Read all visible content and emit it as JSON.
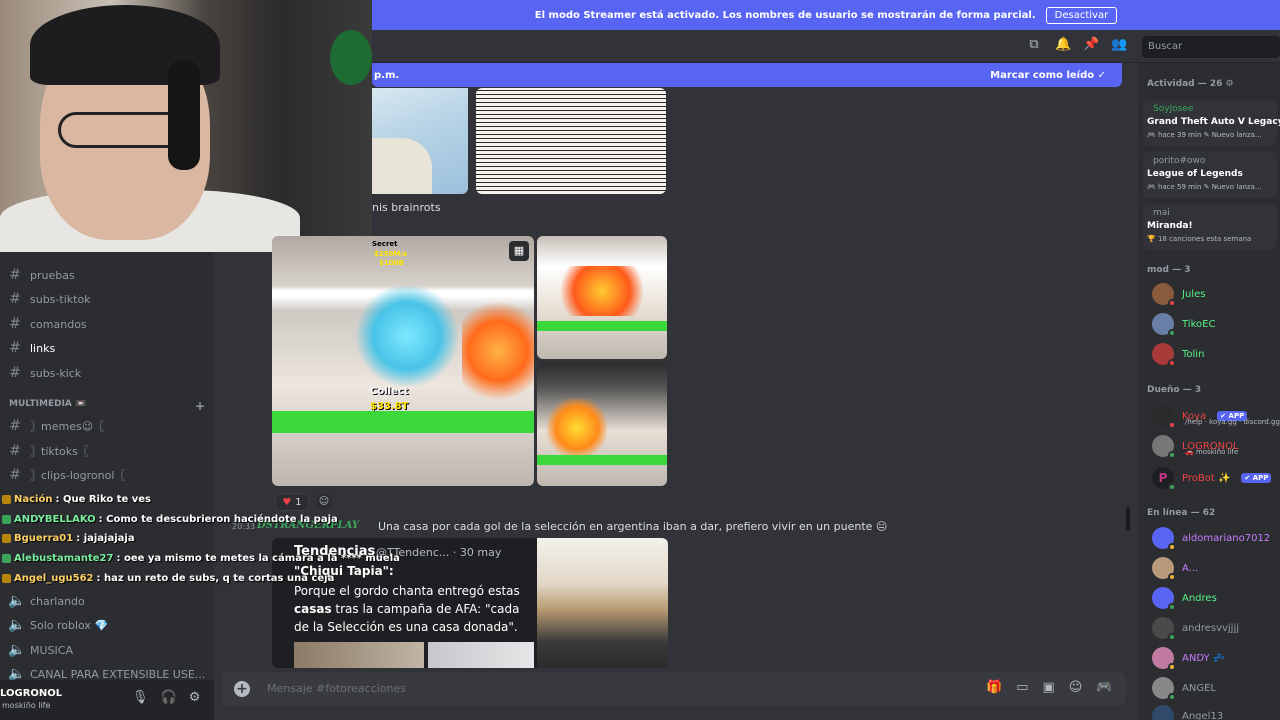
{
  "banner": {
    "text": "El modo Streamer está activado. Los nombres de usuario se mostrarán de forma parcial.",
    "button": "Desactivar"
  },
  "header": {
    "search_placeholder": "Buscar",
    "icons": [
      "threads-icon",
      "bell-icon",
      "pin-icon",
      "members-icon"
    ]
  },
  "newbar": {
    "left": "p.m.",
    "right": "Marcar como leído"
  },
  "sidebar": {
    "channels": [
      {
        "label": "pruebas",
        "top": 0
      },
      {
        "label": "subs-tiktok"
      },
      {
        "label": "​comandos"
      },
      {
        "label": "links",
        "active": true
      },
      {
        "label": "subs-kick"
      }
    ],
    "category": "MULTIMEDIA 📼",
    "media_channels": [
      {
        "label": "〗memes😉〖"
      },
      {
        "label": "〗tiktoks〖"
      },
      {
        "label": "〗clips-logronol〖"
      }
    ],
    "voice_channels": [
      {
        "label": "charlando"
      },
      {
        "label": "Solo roblox 💎"
      },
      {
        "label": "MUSICA"
      },
      {
        "label": "CANAL PARA EXTENSIBLE USE..."
      }
    ],
    "user": {
      "name": "LOGRONOL",
      "status": "moskiño life"
    }
  },
  "chat": [
    {
      "user": "Nación",
      "text": ": Que Riko te ves",
      "color": "#ffd166"
    },
    {
      "user": "ANDYBELLAKO",
      "text": ": Como te descubrieron haciéndote la paja",
      "color": "#7bed9f"
    },
    {
      "user": "Bguerra01",
      "text": ": jajajajaja",
      "color": "#ffd166"
    },
    {
      "user": "Alebustamante27",
      "text": ": oee ya mismo te metes la cámara a la **** muela",
      "color": "#7bed9f"
    },
    {
      "user": "Angel_ugu562",
      "text": ": haz un reto de subs, q te cortas una ceja",
      "color": "#ffd166"
    }
  ],
  "messages": {
    "brainrots_text": "nis brainrots",
    "reaction_count": "1",
    "author": "DSTRANGERPLAY",
    "time": "20:33",
    "message": "Una casa por cada gol de la selección en argentina iban a dar, prefiero vivir en un puente 😐",
    "game_secret": "Secret",
    "game_rate": "$250M/s",
    "game_price": "$100B",
    "game_collect": "Collect",
    "game_amount": "$33.8T"
  },
  "embed": {
    "source": "Tendencias",
    "handle": "@TTendenc... · 30 may",
    "quote": "\"Chiqui Tapia\":",
    "body1": "Porque el gordo chanta entregó estas",
    "body2_bold": "casas",
    "body2": " tras la campaña de AFA: \"cada",
    "body3": "de la Selección es una casa donada\"."
  },
  "composer": {
    "placeholder": "Mensaje #fotoreacciones"
  },
  "members": {
    "activity_header": "Actividad — 26 ⚙",
    "activities": [
      {
        "user": "SoyJosee",
        "user_color": "#3ba55c",
        "title": "Grand Theft Auto V Legacy",
        "sub": "🎮 hace 39 min  ✎ Nuevo lanza..."
      },
      {
        "user": "porito#owo",
        "user_color": "#949ba4",
        "title": "League of Legends",
        "sub": "🎮 hace 59 min  ✎ Nuevo lanza..."
      },
      {
        "user": "mai",
        "user_color": "#949ba4",
        "title": "Miranda!",
        "sub": "🏆 18 canciones esta semana"
      }
    ],
    "mod_header": "mod — 3",
    "mods": [
      {
        "name": "Jules",
        "color": "#57f287"
      },
      {
        "name": "TikoEC",
        "color": "#57f287"
      },
      {
        "name": "Tolin",
        "color": "#57f287"
      }
    ],
    "owner_header": "Dueño — 3",
    "owners": [
      {
        "name": "Koya",
        "color": "#ed4245",
        "app": "✔ APP",
        "sub": "/help · koya.gg · discord.gg"
      },
      {
        "name": "LOGRONOL",
        "color": "#ed4245",
        "sub": "🚗 moskiño life"
      },
      {
        "name": "ProBot ✨",
        "color": "#ed4245",
        "app": "✔ APP"
      }
    ],
    "online_header": "En línea — 62",
    "online": [
      {
        "name": "aldomariano7012",
        "color": "#c77dff"
      },
      {
        "name": "A...",
        "color": "#c77dff"
      },
      {
        "name": "Andres",
        "color": "#57f287"
      },
      {
        "name": "andresvvjjjj",
        "color": "#949ba4"
      },
      {
        "name": "ANDY 💤",
        "color": "#c77dff"
      },
      {
        "name": "ANGEL",
        "color": "#949ba4"
      },
      {
        "name": "Angel13",
        "color": "#949ba4"
      }
    ]
  }
}
